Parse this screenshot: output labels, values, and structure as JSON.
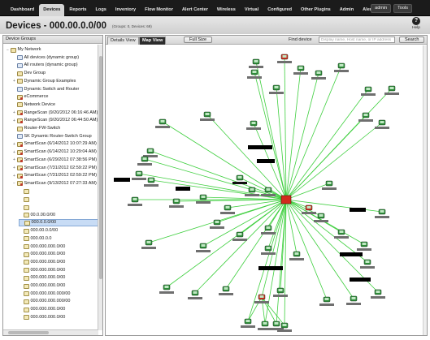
{
  "nav": {
    "tabs": [
      "Dashboard",
      "Devices",
      "Reports",
      "Logs",
      "Inventory",
      "Flow Monitor",
      "Alert Center",
      "Wireless",
      "Virtual",
      "Configured",
      "Other Plugins",
      "Admin",
      "AlertFox"
    ],
    "active_tab": "Devices",
    "user": "admin",
    "tools": "Tools"
  },
  "header": {
    "title": "Devices - 000.00.0.0/00",
    "subtitle": "(Groups: 0, Devices: 69)",
    "help_label": "Help"
  },
  "sidebar": {
    "title": "Device Groups",
    "items": [
      {
        "label": "My Network",
        "indent": 0,
        "expander": "−",
        "icon": "group-icon"
      },
      {
        "label": "All devices (dynamic group)",
        "indent": 1,
        "expander": "",
        "icon": "dynamic-group-icon"
      },
      {
        "label": "All routers (dynamic group)",
        "indent": 1,
        "expander": "",
        "icon": "dynamic-group-icon"
      },
      {
        "label": "Dev Group",
        "indent": 1,
        "expander": "",
        "icon": "group-icon"
      },
      {
        "label": "Dynamic Group Examples",
        "indent": 1,
        "expander": "+",
        "icon": "group-icon"
      },
      {
        "label": "Dynamic Switch and Router",
        "indent": 1,
        "expander": "",
        "icon": "dynamic-group-icon"
      },
      {
        "label": "eCommerce",
        "indent": 1,
        "expander": "",
        "icon": "group-alert-icon"
      },
      {
        "label": "Network Device",
        "indent": 1,
        "expander": "",
        "icon": "group-icon"
      },
      {
        "label": "RangeScan (9/20/2012 06:16:46 AM)",
        "indent": 1,
        "expander": "+",
        "icon": "group-alert-icon"
      },
      {
        "label": "RangeScan (9/20/2012 06:44:50 AM)",
        "indent": 1,
        "expander": "+",
        "icon": "group-alert-icon"
      },
      {
        "label": "Router-FW-Switch",
        "indent": 1,
        "expander": "",
        "icon": "group-icon"
      },
      {
        "label": "SK Dynamic Router-Switch Group",
        "indent": 1,
        "expander": "",
        "icon": "dynamic-group-icon"
      },
      {
        "label": "SmartScan (6/14/2012 10:07:29 AM)",
        "indent": 1,
        "expander": "+",
        "icon": "group-alert-icon"
      },
      {
        "label": "SmartScan (6/14/2012 10:29:04 AM)",
        "indent": 1,
        "expander": "+",
        "icon": "group-alert-icon"
      },
      {
        "label": "SmartScan (6/29/2012 07:38:56 PM)",
        "indent": 1,
        "expander": "+",
        "icon": "group-alert-icon"
      },
      {
        "label": "SmartScan (7/31/2012 02:59:22 PM)",
        "indent": 1,
        "expander": "+",
        "icon": "group-alert-icon"
      },
      {
        "label": "SmartScan (7/31/2012 02:59:22 PM)",
        "indent": 1,
        "expander": "+",
        "icon": "group-alert-icon"
      },
      {
        "label": "SmartScan (9/13/2012 07:27:33 AM)",
        "indent": 1,
        "expander": "−",
        "icon": "group-alert-icon"
      },
      {
        "label": "",
        "indent": 2,
        "expander": "",
        "icon": "folder-icon"
      },
      {
        "label": "",
        "indent": 2,
        "expander": "",
        "icon": "folder-icon"
      },
      {
        "label": "",
        "indent": 2,
        "expander": "",
        "icon": "folder-icon"
      },
      {
        "label": "00.0.00.0/00",
        "indent": 2,
        "expander": "",
        "icon": "folder-icon"
      },
      {
        "label": "000.0.0.0/00",
        "indent": 2,
        "expander": "",
        "icon": "folder-icon",
        "selected": true
      },
      {
        "label": "000.00.0.0/00",
        "indent": 2,
        "expander": "",
        "icon": "folder-icon"
      },
      {
        "label": "000.00.0.0",
        "indent": 2,
        "expander": "",
        "icon": "folder-icon"
      },
      {
        "label": "000.000.000.0/00",
        "indent": 2,
        "expander": "",
        "icon": "folder-icon"
      },
      {
        "label": "000.000.000.0/00",
        "indent": 2,
        "expander": "",
        "icon": "folder-icon"
      },
      {
        "label": "000.000.000.0/00",
        "indent": 2,
        "expander": "",
        "icon": "folder-icon"
      },
      {
        "label": "000.000.000.0/00",
        "indent": 2,
        "expander": "",
        "icon": "folder-icon"
      },
      {
        "label": "000.000.000.0/00",
        "indent": 2,
        "expander": "",
        "icon": "folder-icon"
      },
      {
        "label": "000.000.000.0/00",
        "indent": 2,
        "expander": "",
        "icon": "folder-icon"
      },
      {
        "label": "000.000.000.000/00",
        "indent": 2,
        "expander": "",
        "icon": "folder-icon"
      },
      {
        "label": "000.000.000.000/00",
        "indent": 2,
        "expander": "",
        "icon": "folder-icon"
      },
      {
        "label": "000.000.000.0/00",
        "indent": 2,
        "expander": "",
        "icon": "folder-icon"
      },
      {
        "label": "000.000.000.0/00",
        "indent": 2,
        "expander": "",
        "icon": "folder-icon"
      }
    ]
  },
  "main": {
    "tabs": [
      "Details View",
      "Map View"
    ],
    "active_tab": "Map View",
    "full_size_label": "Full Size",
    "find_label": "Find device",
    "find_placeholder": "Display name, Host name, or IP address",
    "search_label": "Search"
  },
  "map": {
    "link_color": "#3ecf3e",
    "device_color": "#2f8f3a",
    "alert_color": "#d22a1e"
  }
}
